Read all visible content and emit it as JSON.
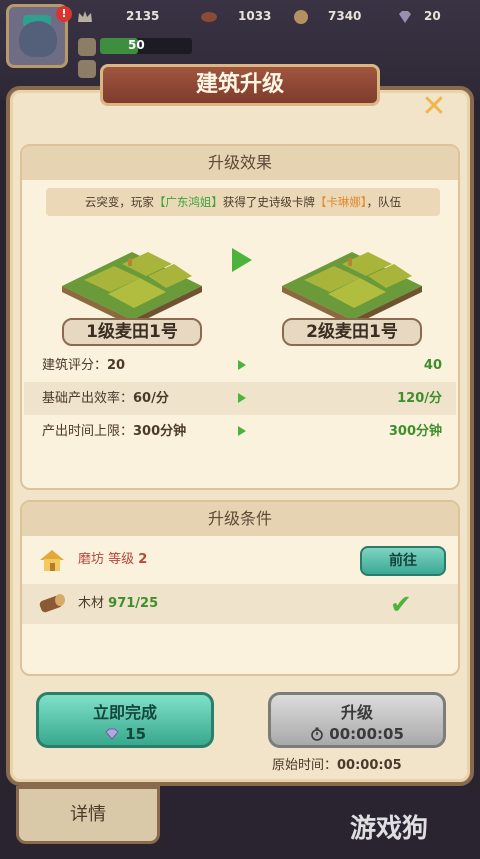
{
  "hud": {
    "alert": "!",
    "crown_value": "2135",
    "rugby_value": "1033",
    "coin_value": "7340",
    "gem_value": "20",
    "level_value": "50"
  },
  "dialog": {
    "title": "建筑升级",
    "close": "✕"
  },
  "effect": {
    "header": "升级效果",
    "marquee_prefix": "云突变，玩家",
    "marquee_player": "【广东鸿姐】",
    "marquee_mid": "获得了史诗级卡牌",
    "marquee_card": "【卡琳娜】",
    "marquee_suffix": "，队伍",
    "from_name": "1级麦田1号",
    "to_name": "2级麦田1号",
    "stats": [
      {
        "label": "建筑评分：",
        "from": "20",
        "to": "40"
      },
      {
        "label": "基础产出效率：",
        "from": "60/分",
        "to": "120/分"
      },
      {
        "label": "产出时间上限：",
        "from": "300分钟",
        "to": "300分钟"
      }
    ]
  },
  "conditions": {
    "header": "升级条件",
    "items": [
      {
        "name": "磨坊 等级",
        "value": "2",
        "action": "前往"
      },
      {
        "name": "木材",
        "value": "971/25"
      }
    ]
  },
  "actions": {
    "instant_label": "立即完成",
    "instant_cost": "15",
    "upgrade_label": "升级",
    "upgrade_time": "00:00:05",
    "orig_time_label": "原始时间：",
    "orig_time_value": "00:00:05"
  },
  "footer": {
    "details_tab": "详情",
    "watermark": "游戏狗"
  },
  "colors": {
    "accent_green": "#4cb43a",
    "teal_button": "#3aa893",
    "panel_bg": "#f1e4c9",
    "title_ribbon": "#8f4634"
  }
}
